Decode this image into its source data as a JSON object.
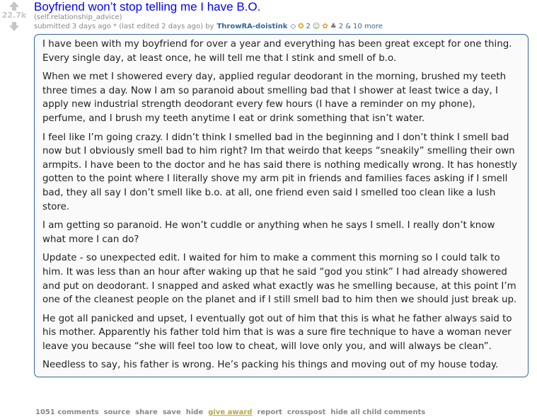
{
  "post": {
    "score": "22.7k",
    "title": "Boyfriend won’t stop telling me I have B.O.",
    "domain": "(self.relationship_advice)",
    "submitted": "submitted 3 days ago * (last edited 2 days ago) by",
    "author": "ThrowRA-doistink",
    "awards": [
      {
        "icon": "silver-award-icon",
        "glyph": "◇",
        "count": ""
      },
      {
        "icon": "gold-award-icon",
        "glyph": "✪",
        "count": "2"
      },
      {
        "icon": "wholesome-award-icon",
        "glyph": "☺",
        "count": ""
      },
      {
        "icon": "hugz-award-icon",
        "glyph": "✿",
        "count": ""
      },
      {
        "icon": "helpful-award-icon",
        "glyph": "♣",
        "count": "2"
      }
    ],
    "awards_more": "& 10 more"
  },
  "selftext": [
    "I have been with my boyfriend for over a year and everything has been great except for one thing. Every single day, at least once, he will tell me that I stink and smell of b.o.",
    "When we met I showered every day, applied regular deodorant in the morning, brushed my teeth three times a day. Now I am so paranoid about smelling bad that I shower at least twice a day, I apply new industrial strength deodorant every few hours (I have a reminder on my phone), perfume, and I brush my teeth anytime I eat or drink something that isn’t water.",
    "I feel like I’m going crazy. I didn’t think I smelled bad in the beginning and I don’t think I smell bad now but I obviously smell bad to him right? Im that weirdo that keeps “sneakily” smelling their own armpits. I have been to the doctor and he has said there is nothing medically wrong. It has honestly gotten to the point where I literally shove my arm pit in friends and families faces asking if I smell bad, they all say I don’t smell like b.o. at all, one friend even said I smelled too clean like a lush store.",
    "I am getting so paranoid. He won’t cuddle or anything when he says I smell. I really don’t know what more I can do?",
    "Update - so unexpected edit. I waited for him to make a comment this morning so I could talk to him. It was less than an hour after waking up that he said “god you stink” I had already showered and put on deodorant. I snapped and asked what exactly was he smelling because, at this point I’m one of the cleanest people on the planet and if I still smell bad to him then we should just break up.",
    "He got all panicked and upset, I eventually got out of him that this is what he father always said to his mother. Apparently his father told him that is was a sure fire technique to have a woman never leave you because “she will feel too low to cheat, will love only you, and will always be clean”.",
    "Needless to say, his father is wrong. He’s packing his things and moving out of my house today."
  ],
  "buttons": {
    "comments": "1051 comments",
    "source": "source",
    "share": "share",
    "save": "save",
    "hide": "hide",
    "give_award": "give award",
    "report": "report",
    "crosspost": "crosspost",
    "hide_children": "hide all child comments"
  }
}
